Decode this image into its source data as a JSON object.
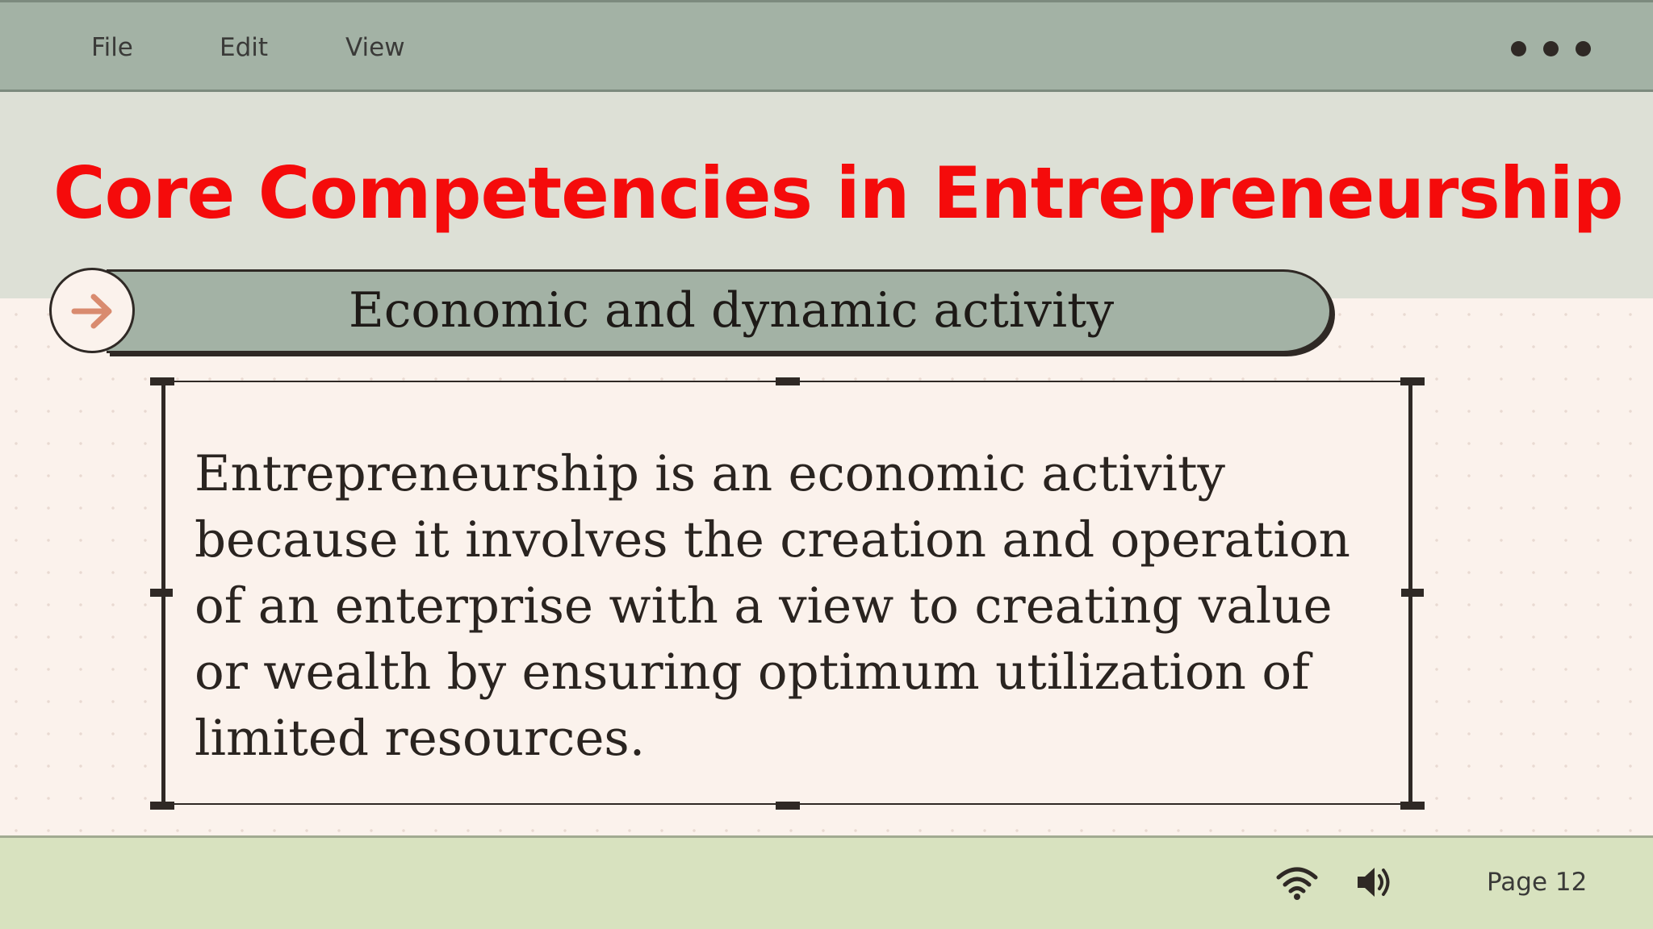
{
  "menu": {
    "file": "File",
    "edit": "Edit",
    "view": "View"
  },
  "slide": {
    "title": "Core Competencies in Entrepreneurship",
    "subtitle": "Economic and dynamic activity",
    "body": "Entrepreneurship is an economic activity because it involves the creation and operation of an enterprise with a view to creating value or wealth by ensuring optimum utilization of limited resources."
  },
  "status": {
    "page": "Page 12"
  },
  "icons": {
    "more": "more-dots-icon",
    "arrow": "arrow-right-icon",
    "wifi": "wifi-icon",
    "volume": "volume-icon"
  },
  "colors": {
    "menubar": "#a3b2a5",
    "title_band": "#dde0d6",
    "title": "#f50b0b",
    "background": "#fbf2ec",
    "statusbar": "#d8e2bf",
    "arrow": "#d98b6f",
    "ink": "#2f2925"
  }
}
